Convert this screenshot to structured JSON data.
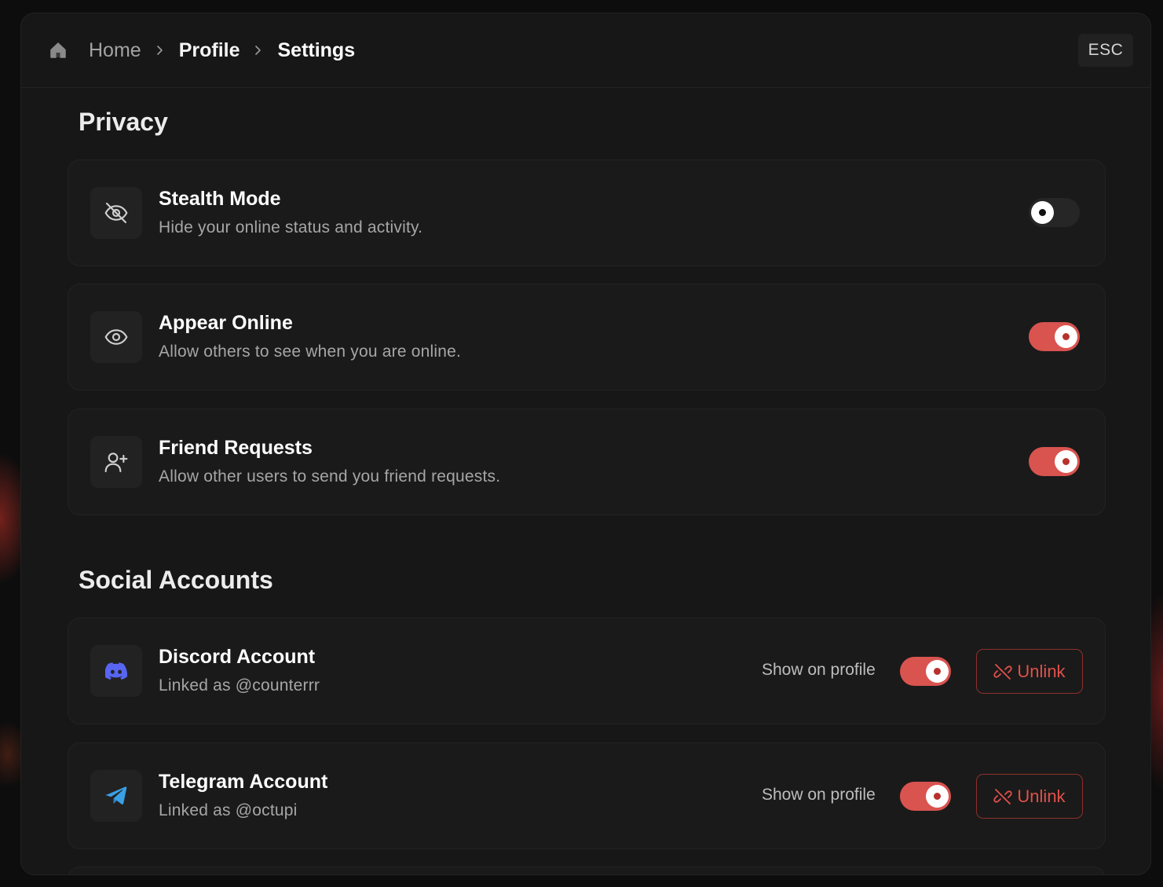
{
  "breadcrumb": {
    "home": "Home",
    "profile": "Profile",
    "settings": "Settings"
  },
  "esc_label": "ESC",
  "privacy": {
    "title": "Privacy",
    "items": [
      {
        "title": "Stealth Mode",
        "description": "Hide your online status and activity.",
        "icon": "eye-off-icon",
        "enabled": false
      },
      {
        "title": "Appear Online",
        "description": "Allow others to see when you are online.",
        "icon": "eye-icon",
        "enabled": true
      },
      {
        "title": "Friend Requests",
        "description": "Allow other users to send you friend requests.",
        "icon": "user-plus-icon",
        "enabled": true
      }
    ]
  },
  "social": {
    "title": "Social Accounts",
    "items": [
      {
        "title": "Discord Account",
        "description": "Linked as @counterrr",
        "icon": "discord-icon",
        "show_label": "Show on profile",
        "show_on_profile": true,
        "unlink_label": "Unlink"
      },
      {
        "title": "Telegram Account",
        "description": "Linked as @octupi",
        "icon": "telegram-icon",
        "show_label": "Show on profile",
        "show_on_profile": true,
        "unlink_label": "Unlink"
      }
    ]
  },
  "colors": {
    "accent": "#d9534f",
    "background": "#171717",
    "card": "#1a1a1a",
    "discord": "#5865f2",
    "telegram": "#3aa0e6"
  }
}
